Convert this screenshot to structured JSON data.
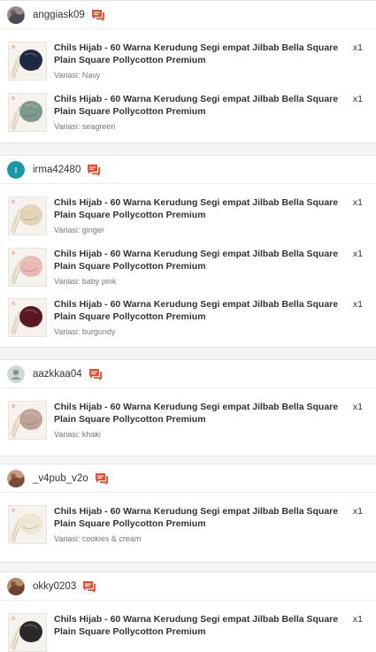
{
  "orders": [
    {
      "username": "anggiask09",
      "avatar": {
        "type": "photo",
        "colors": [
          "#4a4a52",
          "#9a8c86"
        ]
      },
      "chat_icon": "chat-bubble-icon",
      "items": [
        {
          "title": "Chils Hijab - 60 Warna Kerudung Segi empat Jilbab Bella Square Plain Square Pollycotton Premium",
          "qty": "x1",
          "variant": "Variasi: Navy",
          "color": "#1e2a44"
        },
        {
          "title": "Chils Hijab - 60 Warna Kerudung Segi empat Jilbab Bella Square Plain Square Pollycotton Premium",
          "qty": "x1",
          "variant": "Variasi: seagreen",
          "color": "#7e9a8e"
        }
      ]
    },
    {
      "username": "irma42480",
      "avatar": {
        "type": "initial",
        "letter": "I",
        "colors": [
          "#1a9aa8",
          "#ffffff"
        ]
      },
      "chat_icon": "chat-bubble-icon",
      "items": [
        {
          "title": "Chils Hijab - 60 Warna Kerudung Segi empat Jilbab Bella Square Plain Square Pollycotton Premium",
          "qty": "x1",
          "variant": "Variasi: ginger",
          "color": "#e2d3b6"
        },
        {
          "title": "Chils Hijab - 60 Warna Kerudung Segi empat Jilbab Bella Square Plain Square Pollycotton Premium",
          "qty": "x1",
          "variant": "Variasi: baby pink",
          "color": "#e9b9b6"
        },
        {
          "title": "Chils Hijab - 60 Warna Kerudung Segi empat Jilbab Bella Square Plain Square Pollycotton Premium",
          "qty": "x1",
          "variant": "Variasi: burgundy",
          "color": "#5c1820"
        }
      ]
    },
    {
      "username": "aazkkaa04",
      "avatar": {
        "type": "placeholder",
        "colors": [
          "#cfd6da",
          "#8a959b"
        ]
      },
      "chat_icon": "chat-bubble-icon",
      "items": [
        {
          "title": "Chils Hijab - 60 Warna Kerudung Segi empat Jilbab Bella Square Plain Square Pollycotton Premium",
          "qty": "x1",
          "variant": "Variasi: khaki",
          "color": "#c0a49a"
        }
      ]
    },
    {
      "username": "_v4pub_v2o",
      "avatar": {
        "type": "photo",
        "colors": [
          "#7a4a3c",
          "#c99a84"
        ]
      },
      "chat_icon": "chat-bubble-icon",
      "items": [
        {
          "title": "Chils Hijab - 60 Warna Kerudung Segi empat Jilbab Bella Square Plain Square Pollycotton Premium",
          "qty": "x1",
          "variant": "Variasi: cookies & cream",
          "color": "#efe6d2"
        }
      ]
    },
    {
      "username": "okky0203",
      "avatar": {
        "type": "photo",
        "colors": [
          "#6b4330",
          "#b88a6c"
        ]
      },
      "chat_icon": "chat-bubble-icon",
      "items": [
        {
          "title": "Chils Hijab - 60 Warna Kerudung Segi empat Jilbab Bella Square Plain Square Pollycotton Premium",
          "qty": "x1",
          "variant": "",
          "color": "#2a2a2a"
        }
      ]
    }
  ],
  "accent_color": "#ee4d2d"
}
